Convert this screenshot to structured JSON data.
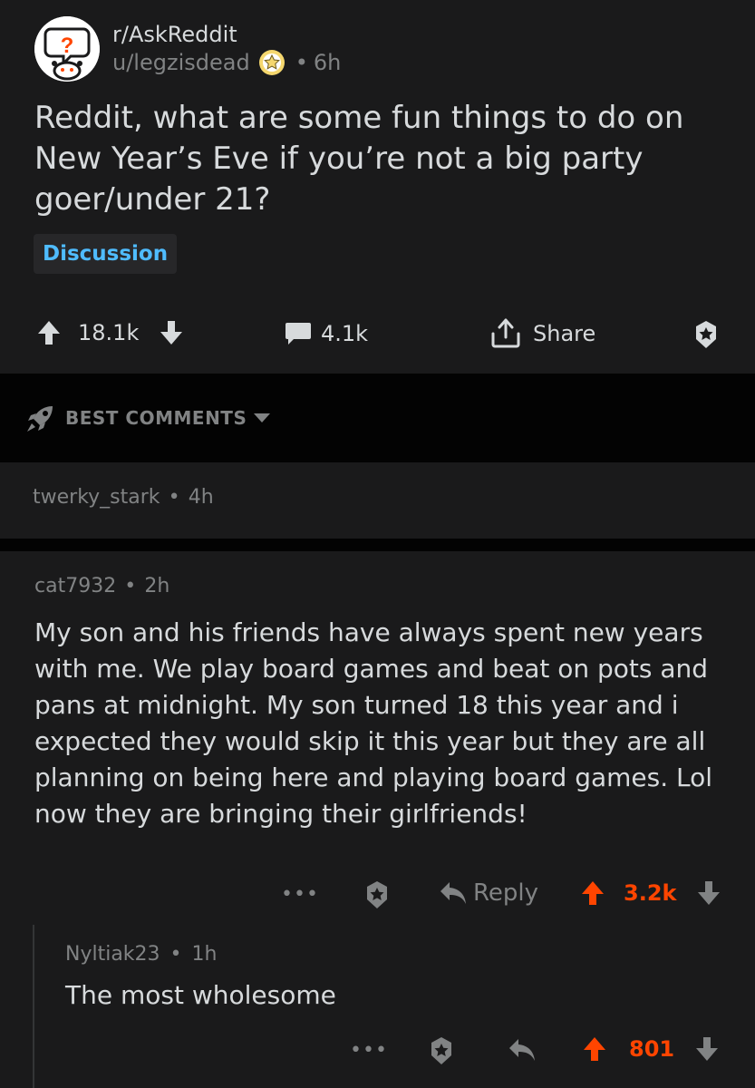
{
  "post": {
    "subreddit": "r/AskReddit",
    "username": "u/legzisdead",
    "separator": "•",
    "age": "6h",
    "title": "Reddit, what are some fun things to do on New Year’s Eve if you’re not a big party goer/under 21?",
    "flair": "Discussion",
    "upvotes": "18.1k",
    "comments": "4.1k",
    "share_label": "Share"
  },
  "sort": {
    "label": "BEST COMMENTS"
  },
  "collapsed_comment": {
    "author": "twerky_stark",
    "separator": "•",
    "age": "4h"
  },
  "comment": {
    "author": "cat7932",
    "separator": "•",
    "age": "2h",
    "body": "My son and his friends have always spent new years with me. We play board games and beat on pots and pans at midnight. My son turned 18 this year and i expected they would skip it this year but they are all planning on being here and playing board games. Lol now they are bringing their girlfriends!",
    "more_label": "•••",
    "reply_label": "Reply",
    "score": "3.2k"
  },
  "reply": {
    "author": "Nyltiak23",
    "separator": "•",
    "age": "1h",
    "body": "The most wholesome",
    "more_label": "•••",
    "score": "801"
  },
  "colors": {
    "background": "#1a1a1b",
    "divider": "#030303",
    "text": "#d7dadc",
    "muted": "#818384",
    "upvote": "#ff4500",
    "flair_text": "#4fbcff"
  }
}
